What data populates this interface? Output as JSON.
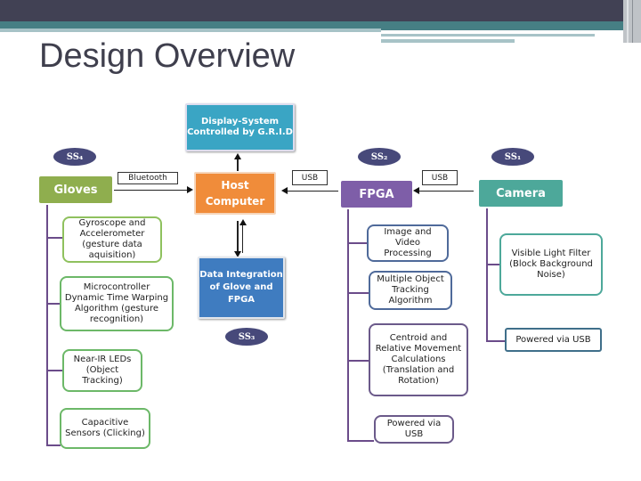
{
  "slide": {
    "title": "Design Overview"
  },
  "colors": {
    "header_dark": "#414154",
    "header_teal": "#467f84",
    "gloves": "#8fae4e",
    "host": "#f08c3a",
    "display": "#3aa5c4",
    "data_integration": "#3f7cc0",
    "fpga": "#7e5ea8",
    "camera": "#4da89a",
    "subsystem_oval": "#47497a"
  },
  "subsystems": {
    "ss1": "SS₁",
    "ss2": "SS₂",
    "ss3": "SS₃",
    "ss4": "SS₄"
  },
  "nodes": {
    "display": "Display-System Controlled by G.R.I.D",
    "host": "Host Computer",
    "data_integration": "Data Integration of Glove and FPGA",
    "gloves": "Gloves",
    "fpga": "FPGA",
    "camera": "Camera"
  },
  "connections": {
    "gloves_to_host": "Bluetooth",
    "fpga_to_host": "USB",
    "camera_to_fpga": "USB"
  },
  "gloves_items": [
    "Gyroscope and Accelerometer (gesture data aquisition)",
    "Microcontroller Dynamic Time Warping Algorithm (gesture recognition)",
    "Near-IR LEDs (Object Tracking)",
    "Capacitive Sensors (Clicking)"
  ],
  "fpga_items": [
    "Image and Video Processing",
    "Multiple Object Tracking Algorithm",
    "Centroid and Relative Movement Calculations (Translation and Rotation)",
    "Powered via USB"
  ],
  "camera_items": [
    "Visible Light Filter (Block Background Noise)",
    "Powered via USB"
  ]
}
